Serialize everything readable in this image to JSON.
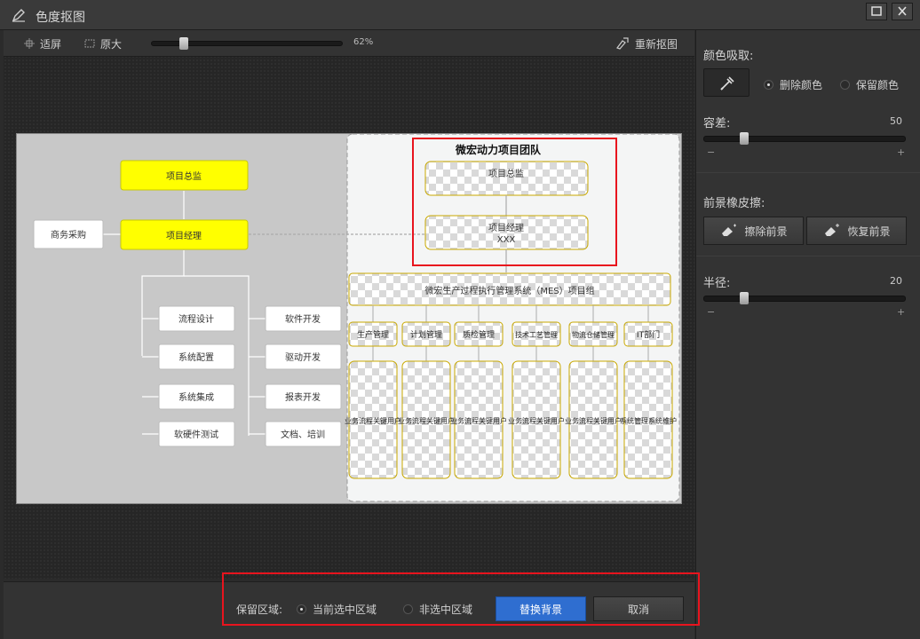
{
  "window": {
    "title": "色度抠图"
  },
  "toolbar": {
    "fit_label": "适屏",
    "original_label": "原大",
    "zoom_value": 62,
    "zoom_text": "62%",
    "reset_label": "重新抠图"
  },
  "right_panel": {
    "color_pick_label": "颜色吸取:",
    "delete_color_label": "删除颜色",
    "keep_color_label": "保留颜色",
    "selected_mode": "delete",
    "tolerance_label": "容差:",
    "tolerance_value": 50,
    "tolerance_text": "50",
    "eraser_label": "前景橡皮擦:",
    "erase_fg_label": "擦除前景",
    "restore_fg_label": "恢复前景",
    "radius_label": "半径:",
    "radius_value": 20,
    "radius_text": "20",
    "minus": "−",
    "plus": "+"
  },
  "bottom": {
    "keep_area_label": "保留区域:",
    "current_selection_label": "当前选中区域",
    "non_selection_label": "非选中区域",
    "replace_bg_label": "替换背景",
    "cancel_label": "取消"
  },
  "diagram": {
    "left": {
      "director": "项目总监",
      "manager": "项目经理",
      "procurement": "商务采购",
      "items_left": [
        "流程设计",
        "系统配置",
        "系统集成",
        "软硬件测试"
      ],
      "items_right": [
        "软件开发",
        "驱动开发",
        "报表开发",
        "文档、培训"
      ]
    },
    "right": {
      "team_title": "微宏动力项目团队",
      "director": "项目总监",
      "manager_line1": "项目经理",
      "manager_line2": "XXX",
      "mes_group": "微宏生产过程执行管理系统（MES）项目组",
      "departments": [
        "生产管理",
        "计划管理",
        "质检管理",
        "技术工艺管理",
        "物流仓储管理",
        "IT部门"
      ],
      "key_users": [
        "业务流程关键用户",
        "业务流程关键用户",
        "业务流程关键用户",
        "业务流程关键用户",
        "业务流程关键用户",
        "系统管理系统维护"
      ]
    }
  },
  "colors": {
    "accent": "#2f6ed0",
    "highlight": "#e8141e",
    "box_yellow": "#ffff00"
  }
}
